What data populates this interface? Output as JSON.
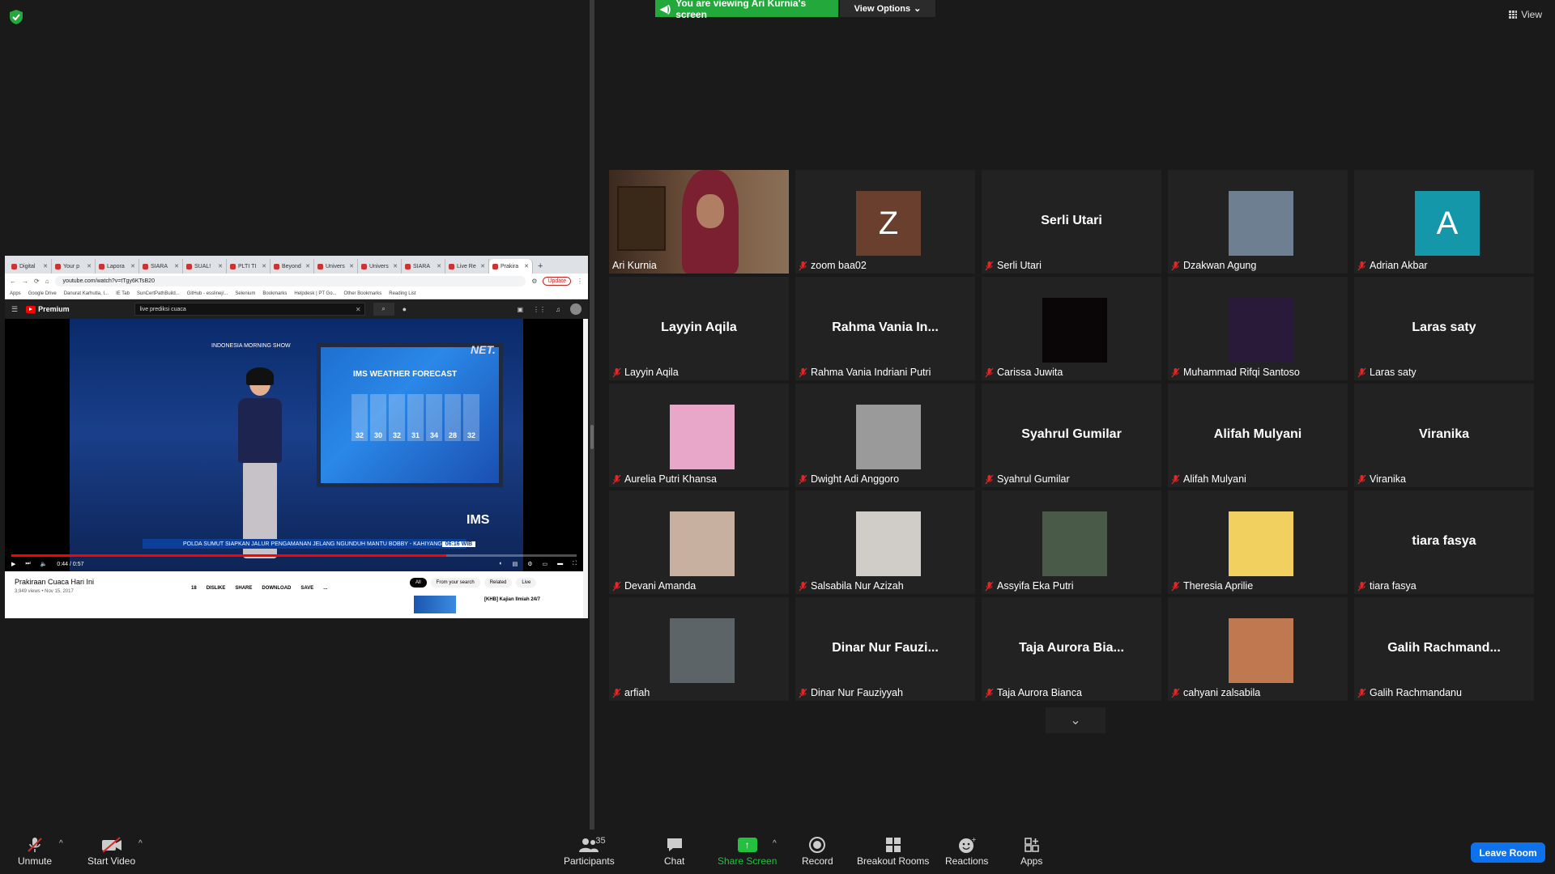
{
  "banner": {
    "viewing": "You are viewing Ari Kurnia's screen",
    "view_options": "View Options",
    "view": "View"
  },
  "shared_screen": {
    "tabs": [
      "Digital",
      "Your p",
      "Lapora",
      "SIARA",
      "SUAL!",
      "PLTI TI",
      "Beyond",
      "Univers",
      "Univers",
      "SIARA",
      "Live Re",
      "Prakira"
    ],
    "url": "youtube.com/watch?v=tTgy6KTsB20",
    "update_label": "Update",
    "bookmarks": [
      "Apps",
      "Google Drive",
      "Danurat Karhutla, I...",
      "IE Tab",
      "SunCertPathBuild...",
      "GitHub - esslinej/...",
      "Selenium",
      "Bookmarks",
      "Helpdesk | PT Go...",
      "Other Bookmarks",
      "Reading List"
    ],
    "youtube": {
      "brand": "Premium",
      "search_query": "live prediksi cuaca",
      "video_title": "Prakiraan Cuaca Hari Ini",
      "video_meta": "3,949 views • Nov 15, 2017",
      "time": "0:44 / 0:57",
      "progress": 0.77,
      "actions": [
        "18",
        "DISLIKE",
        "SHARE",
        "DOWNLOAD",
        "SAVE",
        "..."
      ],
      "chips": [
        "All",
        "From your search",
        "Related",
        "Live"
      ],
      "rec_title": "[KHB] Kajian Ilmiah 24/7",
      "overlay": {
        "show": "INDONESIA MORNING SHOW",
        "channel": "NET.",
        "forecast_title": "IMS WEATHER FORECAST",
        "temps": [
          "32",
          "30",
          "32",
          "31",
          "34",
          "28",
          "32"
        ],
        "ims": "IMS",
        "ticker": "POLDA SUMUT SIAPKAN JALUR PENGAMANAN JELANG NGUNDUH MANTU BOBBY - KAHIYANG",
        "ticker_time": "06:16 WIB"
      }
    }
  },
  "participants": [
    {
      "display": "video",
      "name": "Ari Kurnia",
      "active": true
    },
    {
      "display": "initial",
      "initial": "Z",
      "color": "#6b3f2e",
      "name": "zoom baa02"
    },
    {
      "display": "name",
      "big": "Serli Utari",
      "name": "Serli Utari"
    },
    {
      "display": "photo",
      "color": "#6f7f92",
      "name": "Dzakwan Agung"
    },
    {
      "display": "initial",
      "initial": "A",
      "color": "#1497a9",
      "name": "Adrian Akbar"
    },
    {
      "display": "name",
      "big": "Layyin Aqila",
      "name": "Layyin Aqila"
    },
    {
      "display": "name",
      "big": "Rahma Vania In...",
      "name": "Rahma Vania Indriani Putri"
    },
    {
      "display": "photo",
      "color": "#0a0608",
      "name": "Carissa Juwita"
    },
    {
      "display": "photo",
      "color": "#2a1a3a",
      "name": "Muhammad Rifqi Santoso"
    },
    {
      "display": "name",
      "big": "Laras saty",
      "name": "Laras saty"
    },
    {
      "display": "photo",
      "color": "#e8a6c8",
      "name": "Aurelia Putri Khansa"
    },
    {
      "display": "photo",
      "color": "#9a9a9a",
      "name": "Dwight Adi Anggoro"
    },
    {
      "display": "name",
      "big": "Syahrul Gumilar",
      "name": "Syahrul Gumilar"
    },
    {
      "display": "name",
      "big": "Alifah Mulyani",
      "name": "Alifah Mulyani"
    },
    {
      "display": "name",
      "big": "Viranika",
      "name": "Viranika"
    },
    {
      "display": "photo",
      "color": "#c8b0a0",
      "name": "Devani Amanda"
    },
    {
      "display": "photo",
      "color": "#d0ccc8",
      "name": "Salsabila Nur Azizah"
    },
    {
      "display": "photo",
      "color": "#4a5a48",
      "name": "Assyifa Eka Putri"
    },
    {
      "display": "photo",
      "color": "#f2d060",
      "name": "Theresia Aprilie"
    },
    {
      "display": "name",
      "big": "tiara fasya",
      "name": "tiara fasya"
    },
    {
      "display": "photo",
      "color": "#5c6468",
      "name": "arfiah"
    },
    {
      "display": "name",
      "big": "Dinar Nur Fauzi...",
      "name": "Dinar Nur Fauziyyah"
    },
    {
      "display": "name",
      "big": "Taja Aurora Bia...",
      "name": "Taja Aurora Bianca"
    },
    {
      "display": "photo",
      "color": "#c07850",
      "name": "cahyani zalsabila"
    },
    {
      "display": "name",
      "big": "Galih  Rachmand...",
      "name": "Galih Rachmandanu"
    }
  ],
  "toolbar": {
    "unmute": "Unmute",
    "start_video": "Start Video",
    "participants": "Participants",
    "participants_count": "35",
    "chat": "Chat",
    "share_screen": "Share Screen",
    "record": "Record",
    "breakout_rooms": "Breakout Rooms",
    "reactions": "Reactions",
    "apps": "Apps",
    "leave_room": "Leave Room"
  }
}
